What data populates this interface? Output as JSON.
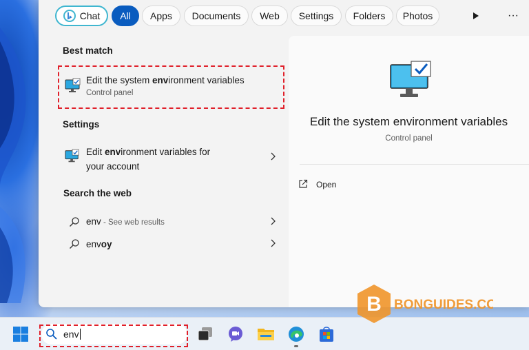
{
  "filters": {
    "chat_label": "Chat",
    "tabs": [
      "All",
      "Apps",
      "Documents",
      "Web",
      "Settings",
      "Folders",
      "Photos"
    ],
    "active_tab": "All",
    "more_label": "···"
  },
  "best_match": {
    "heading": "Best match",
    "title_pre": "Edit the system ",
    "title_bold": "env",
    "title_post": "ironment variables",
    "subtitle": "Control panel"
  },
  "settings": {
    "heading": "Settings",
    "title_pre": "Edit ",
    "title_bold": "env",
    "title_post": "ironment variables for",
    "title_line2": "your account"
  },
  "web": {
    "heading": "Search the web",
    "items": [
      {
        "query": "env",
        "suffix": " - See web results"
      },
      {
        "query_pre": "env",
        "query_bold": "oy"
      }
    ]
  },
  "detail": {
    "title": "Edit the system environment variables",
    "subtitle": "Control panel",
    "open_label": "Open"
  },
  "taskbar": {
    "search_value": "env",
    "apps": [
      "start-icon",
      "task-view-icon",
      "teams-chat-icon",
      "file-explorer-icon",
      "edge-icon",
      "store-icon"
    ]
  },
  "watermark": {
    "text": "BONGUIDES.COM",
    "letter": "B"
  },
  "colors": {
    "accent": "#0a5cbf",
    "highlight": "#e0202a",
    "watermark": "#f0952a"
  }
}
